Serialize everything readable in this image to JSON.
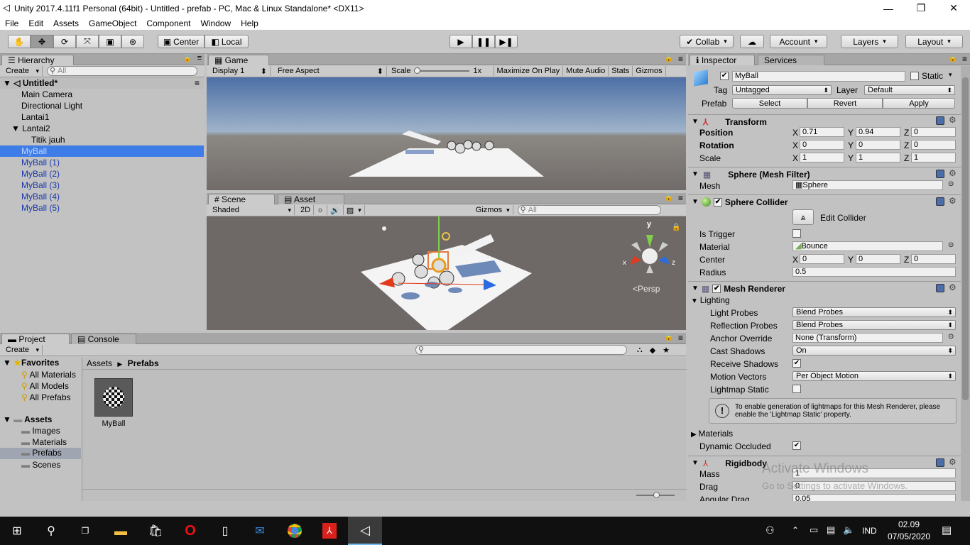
{
  "window": {
    "title": "Unity 2017.4.11f1 Personal (64bit) - Untitled - prefab - PC, Mac & Linux Standalone* <DX11>"
  },
  "menu": [
    "File",
    "Edit",
    "Assets",
    "GameObject",
    "Component",
    "Window",
    "Help"
  ],
  "toolbar": {
    "center": "Center",
    "local": "Local",
    "collab": "Collab",
    "account": "Account",
    "layers": "Layers",
    "layout": "Layout"
  },
  "hierarchy": {
    "tab": "Hierarchy",
    "create": "Create",
    "search_placeholder": "All",
    "scene": "Untitled*",
    "items": [
      "Main Camera",
      "Directional Light",
      "Lantai1",
      "Lantai2",
      "Titik jauh",
      "MyBall",
      "MyBall (1)",
      "MyBall (2)",
      "MyBall (3)",
      "MyBall (4)",
      "MyBall (5)"
    ]
  },
  "game": {
    "tab": "Game",
    "display": "Display 1",
    "aspect": "Free Aspect",
    "scale_label": "Scale",
    "scale_value": "1x",
    "maximize": "Maximize On Play",
    "mute": "Mute Audio",
    "stats": "Stats",
    "gizmos": "Gizmos"
  },
  "scene": {
    "tab": "Scene",
    "tab2": "Asset Store",
    "shading": "Shaded",
    "mode2d": "2D",
    "gizmos": "Gizmos",
    "search_placeholder": "All",
    "persp": "Persp",
    "axis_x": "x",
    "axis_y": "y",
    "axis_z": "z"
  },
  "project": {
    "tab": "Project",
    "tab2": "Console",
    "create": "Create",
    "favorites": "Favorites",
    "fav_items": [
      "All Materials",
      "All Models",
      "All Prefabs"
    ],
    "assets": "Assets",
    "folders": [
      "Images",
      "Materials",
      "Prefabs",
      "Scenes"
    ],
    "breadcrumb": [
      "Assets",
      "Prefabs"
    ],
    "asset_name": "MyBall"
  },
  "inspector": {
    "tab": "Inspector",
    "tab2": "Services",
    "name": "MyBall",
    "static": "Static",
    "tag_label": "Tag",
    "tag": "Untagged",
    "layer_label": "Layer",
    "layer": "Default",
    "prefab_label": "Prefab",
    "select": "Select",
    "revert": "Revert",
    "apply": "Apply",
    "transform": {
      "title": "Transform",
      "position": "Position",
      "rotation": "Rotation",
      "scale": "Scale",
      "pos": [
        "0.71",
        "0.94",
        "0"
      ],
      "rot": [
        "0",
        "0",
        "0"
      ],
      "scl": [
        "1",
        "1",
        "1"
      ],
      "x": "X",
      "y": "Y",
      "z": "Z"
    },
    "mesh_filter": {
      "title": "Sphere (Mesh Filter)",
      "mesh_label": "Mesh",
      "mesh": "Sphere"
    },
    "collider": {
      "title": "Sphere Collider",
      "edit": "Edit Collider",
      "trigger": "Is Trigger",
      "material_label": "Material",
      "material": "Bounce",
      "center": "Center",
      "center_vals": [
        "0",
        "0",
        "0"
      ],
      "radius_label": "Radius",
      "radius": "0.5"
    },
    "renderer": {
      "title": "Mesh Renderer",
      "lighting": "Lighting",
      "light_probes": "Light Probes",
      "light_probes_val": "Blend Probes",
      "refl_probes": "Reflection Probes",
      "refl_probes_val": "Blend Probes",
      "anchor": "Anchor Override",
      "anchor_val": "None (Transform)",
      "cast": "Cast Shadows",
      "cast_val": "On",
      "receive": "Receive Shadows",
      "motion": "Motion Vectors",
      "motion_val": "Per Object Motion",
      "lightmap": "Lightmap Static",
      "info": "To enable generation of lightmaps for this Mesh Renderer, please enable the 'Lightmap Static' property.",
      "materials": "Materials",
      "dyn": "Dynamic Occluded"
    },
    "rigidbody": {
      "title": "Rigidbody",
      "mass": "Mass",
      "mass_val": "1",
      "drag": "Drag",
      "drag_val": "0",
      "ang": "Angular Drag",
      "ang_val": "0.05"
    }
  },
  "watermark": {
    "line1": "Activate Windows",
    "line2": "Go to Settings to activate Windows."
  },
  "taskbar": {
    "lang": "IND",
    "time": "02.09",
    "date": "07/05/2020"
  },
  "colors": {
    "selection": "#3e7de7",
    "panel": "#c2c2c2",
    "taskbar": "#101010"
  }
}
